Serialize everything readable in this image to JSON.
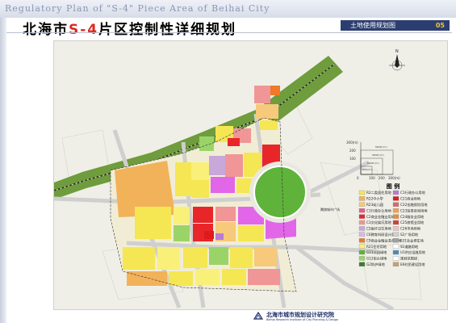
{
  "header": {
    "english_title": "Regulatory Plan of \"S-4\" Piece Area of Beihai City",
    "chinese_title_prefix": "北海市",
    "chinese_title_highlight": "S-4",
    "chinese_title_suffix": "片区控制性详细规划",
    "sheet_title": "土地使用规划图",
    "sheet_number": "05"
  },
  "map": {
    "scale_labels": [
      "300(m)",
      "200",
      "100",
      "0",
      "100",
      "200",
      "300(m)"
    ],
    "scale_unit_labels": [
      "50000 (m²)",
      "20000 (m²)",
      "10000 (m²)",
      "5000 (m²)"
    ],
    "place_label": "腾旗城市广场"
  },
  "legend": {
    "title": "图 例",
    "left_items": [
      {
        "label": "R2二类居住用地",
        "color": "#f5e654"
      },
      {
        "label": "R22中小学",
        "color": "#f2b25a"
      },
      {
        "label": "R23幼儿园",
        "color": "#f7c97a"
      },
      {
        "label": "C1行政办公用地",
        "color": "#e85c8c"
      },
      {
        "label": "C2商业金融业用地",
        "color": "#e8262a"
      },
      {
        "label": "C3文化娱乐用地",
        "color": "#f09696"
      },
      {
        "label": "C5医疗卫生用地",
        "color": "#c7a8d8"
      },
      {
        "label": "C6教育科研设计用地",
        "color": "#d9b8e8"
      },
      {
        "label": "C9商业金融业混合用地",
        "color": "#ef7a28"
      },
      {
        "label": "R21住宅用地",
        "color": "#f9f07a"
      },
      {
        "label": "G11公园绿地",
        "color": "#5fb33a"
      },
      {
        "label": "G12街头绿地",
        "color": "#9ad468"
      },
      {
        "label": "G2防护绿地",
        "color": "#3c7d2a"
      }
    ],
    "right_items": [
      {
        "label": "C1行政办公用地",
        "color": "#b97ad8"
      },
      {
        "label": "C21商业用地",
        "color": "#e01a1a"
      },
      {
        "label": "C22金融保险用地",
        "color": "#d56a6a"
      },
      {
        "label": "C23贸易咨询用地",
        "color": "#f0a050"
      },
      {
        "label": "C24服务业用地",
        "color": "#e88a3a"
      },
      {
        "label": "C25旅馆业用地",
        "color": "#d04040"
      },
      {
        "label": "C26市场用地",
        "color": "#f0c0c0"
      },
      {
        "label": "S2广场用地",
        "color": "#d0d0d0"
      },
      {
        "label": "S31社会停车场",
        "color": "#a0a0a0"
      },
      {
        "label": "S1道路用地",
        "color": "#ffffff"
      },
      {
        "label": "U1供应设施用地",
        "color": "#4a8ac0"
      },
      {
        "label": "规划范围线",
        "color": "#ffffff"
      },
      {
        "label": "E6村民建设用地",
        "color": "#c8a070"
      }
    ]
  },
  "footer": {
    "institute_name": "北海市城市规划设计研究院",
    "institute_english": "Beihai Research Institute of City Planning & Design"
  },
  "colors": {
    "title_red": "#e0281e",
    "header_box": "#2c3e70",
    "header_number": "#f2c43d",
    "green_belt": "#6f9c3c",
    "residential": "#f5e654",
    "commercial": "#e8262a",
    "admin": "#e266e8",
    "park": "#5fb33a"
  }
}
